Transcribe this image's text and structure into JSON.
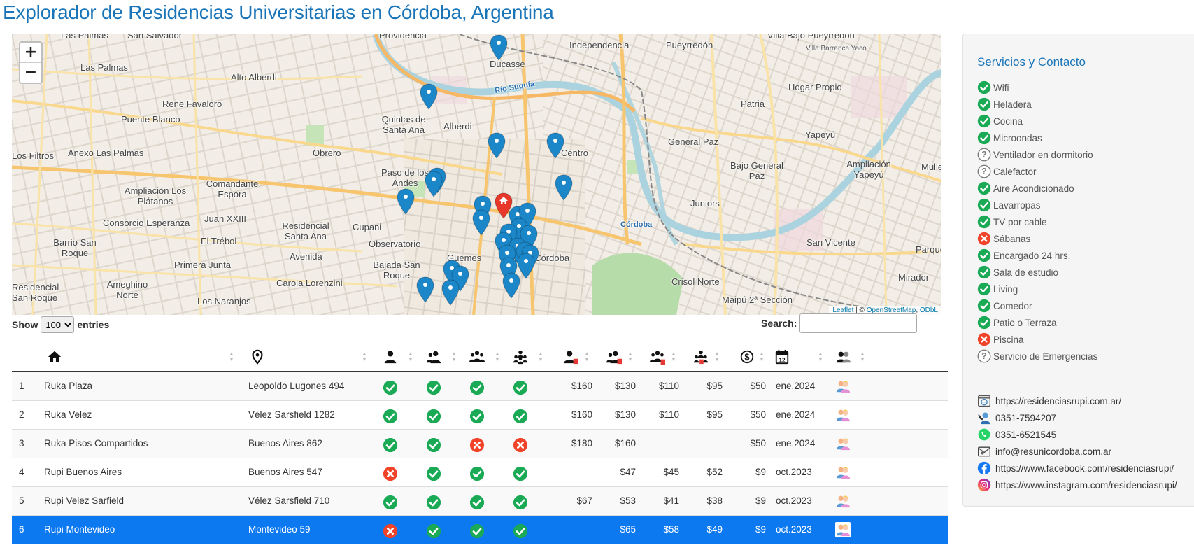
{
  "title": "Explorador de Residencias Universitarias en Córdoba, Argentina",
  "map": {
    "zoom_in": "+",
    "zoom_out": "−",
    "attribution": {
      "leaflet": "Leaflet",
      "sep": " | © ",
      "osm": "OpenStreetMap",
      "comma": ", ",
      "odbl": "ODbL"
    },
    "labels": [
      {
        "text": "Las Palmas",
        "cls": ""
      },
      {
        "text": "San Salvador",
        "cls": ""
      },
      {
        "text": "Providencia",
        "cls": ""
      },
      {
        "text": "Independencia",
        "cls": ""
      },
      {
        "text": "Villa Bajo Pueyrredón",
        "cls": ""
      },
      {
        "text": "Las Palmas",
        "cls": ""
      },
      {
        "text": "Alto Alberdi",
        "cls": ""
      },
      {
        "text": "Ducasse",
        "cls": ""
      },
      {
        "text": "Pueyrredón",
        "cls": ""
      },
      {
        "text": "Villa Barranca Yaco",
        "cls": "small"
      },
      {
        "text": "Hogar Propio",
        "cls": ""
      },
      {
        "text": "Rene Favaloro",
        "cls": ""
      },
      {
        "text": "Alberdi",
        "cls": ""
      },
      {
        "text": "Patria",
        "cls": ""
      },
      {
        "text": "Puente Blanco",
        "cls": ""
      },
      {
        "text": "Quintas de Santa Ana",
        "cls": ""
      },
      {
        "text": "Centro",
        "cls": ""
      },
      {
        "text": "General Paz",
        "cls": ""
      },
      {
        "text": "Yapeyú",
        "cls": ""
      },
      {
        "text": "Anexo Las Palmas",
        "cls": ""
      },
      {
        "text": "Obrero",
        "cls": ""
      },
      {
        "text": "Los Filtros",
        "cls": ""
      },
      {
        "text": "Paso de los Andes",
        "cls": ""
      },
      {
        "text": "Bajo General Paz",
        "cls": ""
      },
      {
        "text": "Ampliación Yapeyú",
        "cls": ""
      },
      {
        "text": "Comandante Espora",
        "cls": ""
      },
      {
        "text": "Ampliación Los Plátanos",
        "cls": ""
      },
      {
        "text": "Juniors",
        "cls": ""
      },
      {
        "text": "Consorcio Esperanza",
        "cls": ""
      },
      {
        "text": "Juan XXIII",
        "cls": ""
      },
      {
        "text": "Cupani",
        "cls": ""
      },
      {
        "text": "Residencial Santa Ana",
        "cls": ""
      },
      {
        "text": "Córdoba",
        "cls": "blue"
      },
      {
        "text": "Barrio San Roque",
        "cls": ""
      },
      {
        "text": "El Trébol",
        "cls": ""
      },
      {
        "text": "Observatorio",
        "cls": ""
      },
      {
        "text": "San Vicente",
        "cls": ""
      },
      {
        "text": "Primera Junta",
        "cls": ""
      },
      {
        "text": "Avenida",
        "cls": ""
      },
      {
        "text": "Güemes",
        "cls": ""
      },
      {
        "text": "Nueva Córdoba",
        "cls": ""
      },
      {
        "text": "Bajada San Roque",
        "cls": ""
      },
      {
        "text": "Ameghino Norte",
        "cls": ""
      },
      {
        "text": "Carola Lorenzini",
        "cls": ""
      },
      {
        "text": "Crisol Norte",
        "cls": ""
      },
      {
        "text": "Mirador",
        "cls": ""
      },
      {
        "text": "Residencial San Roque",
        "cls": ""
      },
      {
        "text": "Los Naranjos",
        "cls": ""
      },
      {
        "text": "Maipú 2ª Sección",
        "cls": ""
      },
      {
        "text": "Río Suquía",
        "cls": "blue"
      },
      {
        "text": "Parque",
        "cls": ""
      },
      {
        "text": "Müller",
        "cls": ""
      }
    ]
  },
  "table_controls": {
    "show": "Show",
    "entries": "entries",
    "length_value": "100",
    "search_label": "Search:"
  },
  "table": {
    "columns": [
      "#",
      "Nombre",
      "Dirección",
      "Ind",
      "Doble",
      "Triple",
      "Cuádruple",
      "P.Ind",
      "P.Doble",
      "P.Triple",
      "P.Cuádruple",
      "Matrícula",
      "Actualización",
      "Contacto"
    ],
    "rows": [
      {
        "n": "1",
        "name": "Ruka Plaza",
        "addr": "Leopoldo Lugones 494",
        "s": [
          "ok",
          "ok",
          "ok",
          "ok"
        ],
        "p": [
          "$160",
          "$130",
          "$110",
          "$95",
          "$50"
        ],
        "date": "ene.2024"
      },
      {
        "n": "2",
        "name": "Ruka Velez",
        "addr": "Vélez Sarsfield 1282",
        "s": [
          "ok",
          "ok",
          "ok",
          "ok"
        ],
        "p": [
          "$160",
          "$130",
          "$110",
          "$95",
          "$50"
        ],
        "date": "ene.2024"
      },
      {
        "n": "3",
        "name": "Ruka Pisos Compartidos",
        "addr": "Buenos Aires 862",
        "s": [
          "ok",
          "ok",
          "no",
          "no"
        ],
        "p": [
          "$180",
          "$160",
          "",
          "",
          "$50"
        ],
        "date": "ene.2024"
      },
      {
        "n": "4",
        "name": "Rupi Buenos Aires",
        "addr": "Buenos Aires 547",
        "s": [
          "no",
          "ok",
          "ok",
          "ok"
        ],
        "p": [
          "",
          "$47",
          "$45",
          "$52",
          "$9"
        ],
        "date": "oct.2023"
      },
      {
        "n": "5",
        "name": "Rupi Velez Sarfield",
        "addr": "Vélez Sarsfield 710",
        "s": [
          "ok",
          "ok",
          "ok",
          "ok"
        ],
        "p": [
          "$67",
          "$53",
          "$41",
          "$38",
          "$9"
        ],
        "date": "oct.2023"
      },
      {
        "n": "6",
        "name": "Rupi Montevideo",
        "addr": "Montevideo 59",
        "s": [
          "no",
          "ok",
          "ok",
          "ok"
        ],
        "p": [
          "",
          "$65",
          "$58",
          "$49",
          "$9"
        ],
        "date": "oct.2023"
      }
    ],
    "selected_row": 5
  },
  "panel": {
    "title": "Servicios y Contacto",
    "services": [
      {
        "label": "Wifi",
        "status": "yes"
      },
      {
        "label": "Heladera",
        "status": "yes"
      },
      {
        "label": "Cocina",
        "status": "yes"
      },
      {
        "label": "Microondas",
        "status": "yes"
      },
      {
        "label": "Ventilador en dormitorio",
        "status": "unknown"
      },
      {
        "label": "Calefactor",
        "status": "unknown"
      },
      {
        "label": "Aire Acondicionado",
        "status": "yes"
      },
      {
        "label": "Lavarropas",
        "status": "yes"
      },
      {
        "label": "TV por cable",
        "status": "yes"
      },
      {
        "label": "Sábanas",
        "status": "no"
      },
      {
        "label": "Encargado 24 hrs.",
        "status": "yes"
      },
      {
        "label": "Sala de estudio",
        "status": "yes"
      },
      {
        "label": "Living",
        "status": "yes"
      },
      {
        "label": "Comedor",
        "status": "yes"
      },
      {
        "label": "Patio o Terraza",
        "status": "yes"
      },
      {
        "label": "Piscina",
        "status": "no"
      },
      {
        "label": "Servicio de Emergencias",
        "status": "unknown"
      }
    ],
    "contacts": [
      {
        "icon": "web-icon",
        "text": "https://residenciasrupi.com.ar/"
      },
      {
        "icon": "phone-icon",
        "text": "0351-7594207"
      },
      {
        "icon": "whatsapp-icon",
        "text": "0351-6521545"
      },
      {
        "icon": "email-icon",
        "text": "info@resunicordoba.com.ar"
      },
      {
        "icon": "facebook-icon",
        "text": "https://www.facebook.com/residenciasrupi/"
      },
      {
        "icon": "instagram-icon",
        "text": "https://www.instagram.com/residenciasrupi/"
      }
    ]
  },
  "colors": {
    "accent": "#1a75b8",
    "ok": "#1aaa55",
    "no": "#f0432a",
    "selected": "#0d79f0",
    "marker": "#1b87c9",
    "marker_home": "#e8382a"
  }
}
